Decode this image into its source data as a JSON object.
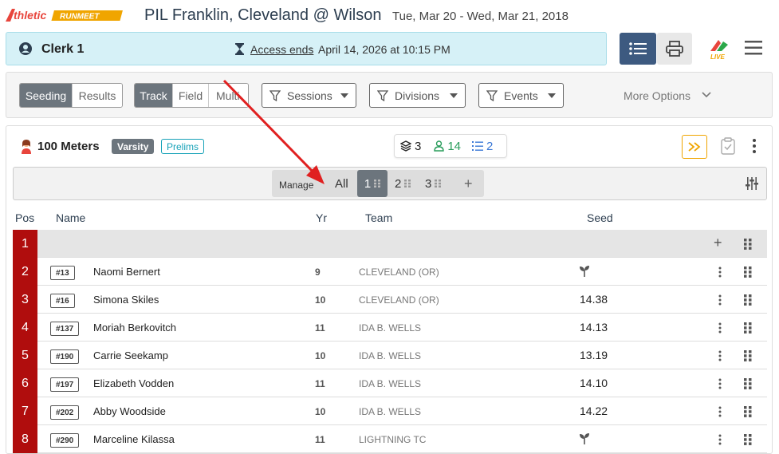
{
  "header": {
    "logo_text": "AthleticRUNMEET",
    "meet_title": "PIL Franklin, Cleveland @ Wilson",
    "meet_dates": "Tue, Mar 20 - Wed, Mar 21, 2018"
  },
  "clerk_bar": {
    "clerk_name": "Clerk 1",
    "access_label": "Access ends",
    "access_value": "April 14, 2026 at 10:15 PM"
  },
  "toolbar": {
    "mode_tabs": [
      {
        "label": "Seeding",
        "active": true
      },
      {
        "label": "Results",
        "active": false
      }
    ],
    "type_tabs": [
      {
        "label": "Track",
        "active": true
      },
      {
        "label": "Field",
        "active": false
      },
      {
        "label": "Multi",
        "active": false
      }
    ],
    "filters": [
      {
        "label": "Sessions"
      },
      {
        "label": "Divisions"
      },
      {
        "label": "Events"
      }
    ],
    "more_options": "More Options"
  },
  "event": {
    "name": "100 Meters",
    "division_badge": "Varsity",
    "round_badge": "Prelims",
    "stats": {
      "heats": "3",
      "athletes": "14",
      "entries": "2"
    }
  },
  "heat_bar": {
    "manage_label": "Manage",
    "all_label": "All",
    "heats": [
      {
        "label": "1",
        "active": true
      },
      {
        "label": "2",
        "active": false
      },
      {
        "label": "3",
        "active": false
      }
    ],
    "add_label": "+"
  },
  "table": {
    "headers": {
      "pos": "Pos",
      "name": "Name",
      "yr": "Yr",
      "team": "Team",
      "seed": "Seed"
    },
    "rows": [
      {
        "pos": "1",
        "empty": true,
        "bib": "",
        "name": "",
        "yr": "",
        "team": "",
        "seed": ""
      },
      {
        "pos": "2",
        "empty": false,
        "bib": "#13",
        "name": "Naomi Bernert",
        "yr": "9",
        "team": "CLEVELAND (OR)",
        "seed": "",
        "seed_icon": "sprout-icon"
      },
      {
        "pos": "3",
        "empty": false,
        "bib": "#16",
        "name": "Simona Skiles",
        "yr": "10",
        "team": "CLEVELAND (OR)",
        "seed": "14.38"
      },
      {
        "pos": "4",
        "empty": false,
        "bib": "#137",
        "name": "Moriah Berkovitch",
        "yr": "11",
        "team": "IDA B. WELLS",
        "seed": "14.13"
      },
      {
        "pos": "5",
        "empty": false,
        "bib": "#190",
        "name": "Carrie Seekamp",
        "yr": "10",
        "team": "IDA B. WELLS",
        "seed": "13.19"
      },
      {
        "pos": "6",
        "empty": false,
        "bib": "#197",
        "name": "Elizabeth Vodden",
        "yr": "11",
        "team": "IDA B. WELLS",
        "seed": "14.10"
      },
      {
        "pos": "7",
        "empty": false,
        "bib": "#202",
        "name": "Abby Woodside",
        "yr": "10",
        "team": "IDA B. WELLS",
        "seed": "14.22"
      },
      {
        "pos": "8",
        "empty": false,
        "bib": "#290",
        "name": "Marceline Kilassa",
        "yr": "11",
        "team": "LIGHTNING TC",
        "seed": "",
        "seed_icon": "sprout-icon"
      }
    ]
  },
  "colors": {
    "pos_red": "#b00d0d",
    "clerk_bar_bg": "#d6f1f7",
    "primary_navy": "#3d5a80",
    "annotation_arrow": "#e02020"
  }
}
